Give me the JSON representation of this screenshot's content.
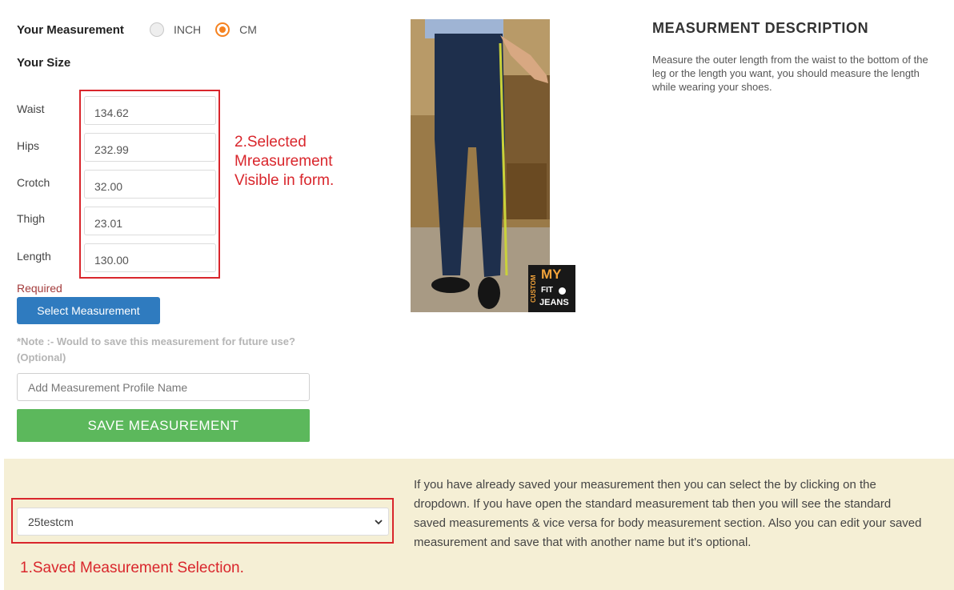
{
  "measurement": {
    "title": "Your Measurement",
    "options": [
      {
        "label": "INCH",
        "selected": false
      },
      {
        "label": "CM",
        "selected": true
      }
    ]
  },
  "size_title": "Your Size",
  "fields": [
    {
      "label": "Waist",
      "value": "134.62"
    },
    {
      "label": "Hips",
      "value": "232.99"
    },
    {
      "label": "Crotch",
      "value": "32.00"
    },
    {
      "label": "Thigh",
      "value": "23.01"
    },
    {
      "label": "Length",
      "value": "130.00"
    }
  ],
  "annotations": {
    "form_note": "2.Selected\nMreasurement\nVisible in form.",
    "dropdown_note": "1.Saved Measurement Selection."
  },
  "required_text": "Required",
  "select_button": "Select Measurement",
  "note": "*Note :- Would to save this measurement for future use? (Optional)",
  "profile_input": {
    "placeholder": "Add Measurement Profile Name"
  },
  "save_button": "SAVE MEASUREMENT",
  "photo_badge": {
    "custom": "CUSTOM",
    "my": "MY",
    "fit": "FIT",
    "jeans": "JEANS"
  },
  "description": {
    "title": "MEASURMENT DESCRIPTION",
    "text": "Measure the outer length from the waist to the bottom of the leg or the length you want, you should measure the length while wearing your shoes."
  },
  "saved_selection": {
    "selected": "25testcm"
  },
  "bottom_text": "If you have already saved your measurement then you can select the by clicking on the dropdown. If you have open the standard measurement tab then you will see the standard saved measurements & vice versa for body measurement section. Also you can edit your saved measurement and save that with another name but it's optional.",
  "colors": {
    "accent_orange": "#f58220",
    "button_blue": "#2f7bbf",
    "button_green": "#5cb85c",
    "annotation_red": "#d9262c",
    "band": "#f5efd5"
  }
}
